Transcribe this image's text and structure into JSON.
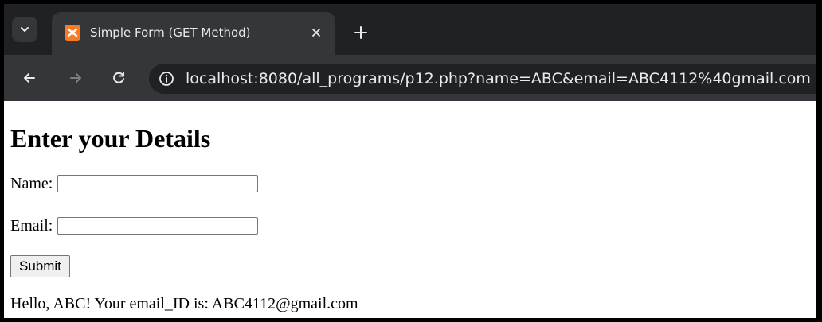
{
  "browser": {
    "tab": {
      "title": "Simple Form (GET Method)",
      "favicon": "xampp-icon"
    },
    "url": "localhost:8080/all_programs/p12.php?name=ABC&email=ABC4112%40gmail.com",
    "colors": {
      "tabstrip": "#202124",
      "toolbar": "#35363a",
      "favicon": "#fb7a24"
    }
  },
  "page": {
    "title": "Enter your Details",
    "form": {
      "name_label": "Name:",
      "name_value": "",
      "email_label": "Email:",
      "email_value": "",
      "submit_label": "Submit"
    },
    "result": "Hello, ABC! Your email_ID is: ABC4112@gmail.com"
  }
}
